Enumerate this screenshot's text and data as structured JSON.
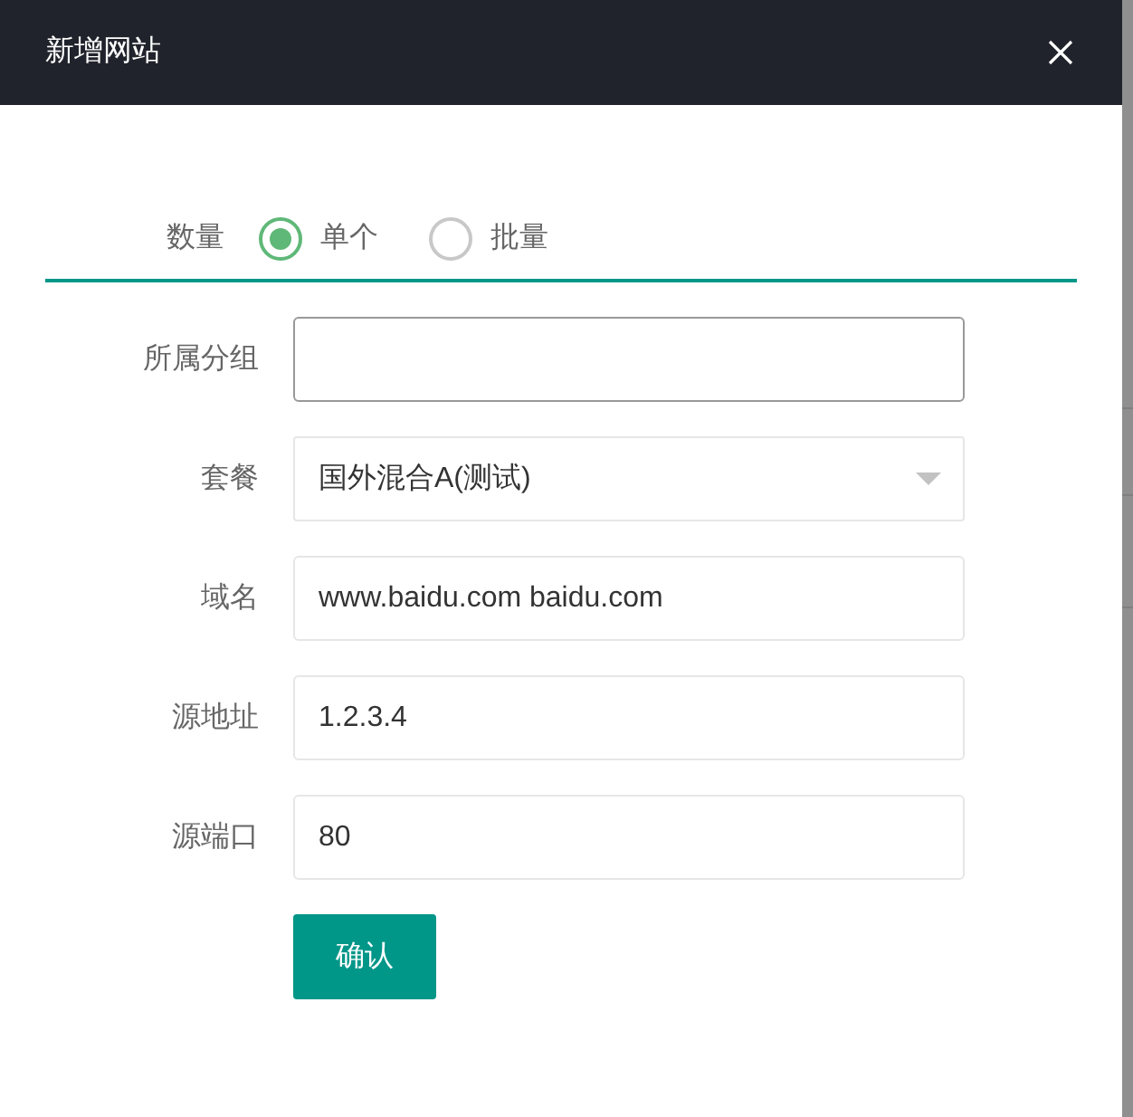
{
  "dialog": {
    "title": "新增网站"
  },
  "quantity": {
    "label": "数量",
    "options": [
      {
        "label": "单个",
        "selected": true
      },
      {
        "label": "批量",
        "selected": false
      }
    ]
  },
  "fields": [
    {
      "kind": "input",
      "label": "所属分组",
      "focused": true
    },
    {
      "kind": "select",
      "label": "套餐",
      "value": "国外混合A(测试)",
      "focused": false
    },
    {
      "kind": "input",
      "label": "域名",
      "value": "www.baidu.com baidu.com",
      "focused": false
    },
    {
      "kind": "input",
      "label": "源地址",
      "value": "1.2.3.4",
      "focused": false
    },
    {
      "kind": "input",
      "label": "源端口",
      "value": "80",
      "focused": false
    }
  ],
  "submit": "确认"
}
